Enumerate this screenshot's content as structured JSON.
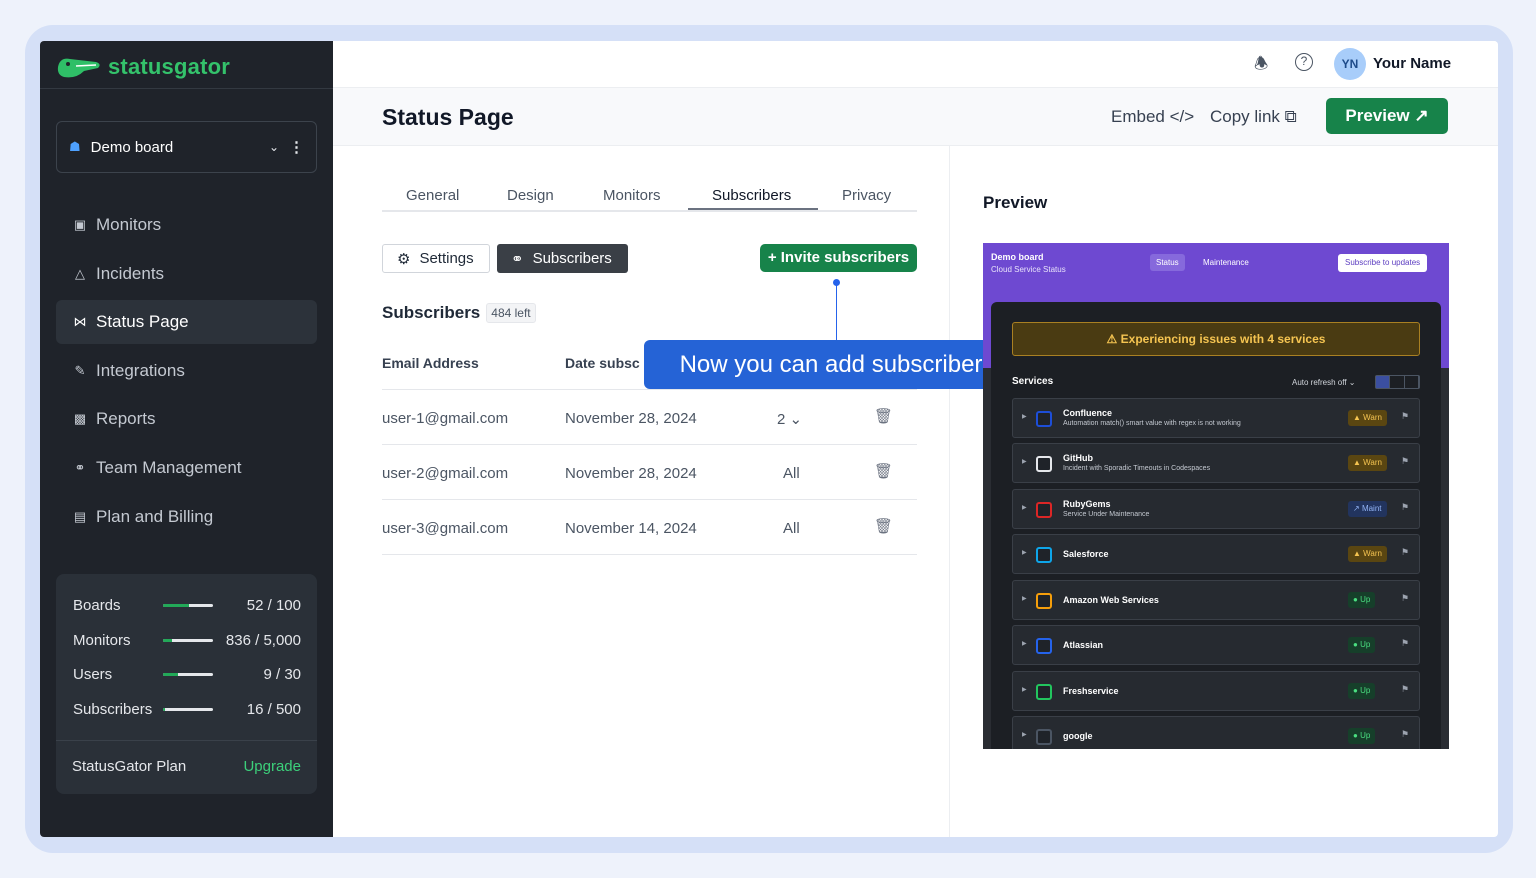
{
  "app": {
    "brand": "statusgator"
  },
  "sidebar": {
    "board_name": "Demo board",
    "items": [
      {
        "label": "Monitors",
        "icon": "monitor-icon"
      },
      {
        "label": "Incidents",
        "icon": "warning-icon"
      },
      {
        "label": "Status Page",
        "icon": "broadcast-icon"
      },
      {
        "label": "Integrations",
        "icon": "puzzle-icon"
      },
      {
        "label": "Reports",
        "icon": "bar-chart-icon"
      },
      {
        "label": "Team Management",
        "icon": "user-icon"
      },
      {
        "label": "Plan and Billing",
        "icon": "credit-card-icon"
      }
    ],
    "usage": [
      {
        "label": "Boards",
        "value": "52 / 100",
        "fraction": 0.52
      },
      {
        "label": "Monitors",
        "value": "836 / 5,000",
        "fraction": 0.17
      },
      {
        "label": "Users",
        "value": "9 / 30",
        "fraction": 0.3
      },
      {
        "label": "Subscribers",
        "value": "16 / 500",
        "fraction": 0.03
      }
    ],
    "plan_label": "StatusGator Plan",
    "upgrade_label": "Upgrade"
  },
  "topbar": {
    "avatar_initials": "YN",
    "user_name": "Your Name"
  },
  "header": {
    "title": "Status Page",
    "embed_label": "Embed",
    "copy_label": "Copy link",
    "preview_label": "Preview"
  },
  "tabs": [
    "General",
    "Design",
    "Monitors",
    "Subscribers",
    "Privacy"
  ],
  "subs": {
    "settings_label": "Settings",
    "subscribers_label": "Subscribers",
    "invite_label": "Invite subscribers",
    "title": "Subscribers",
    "left_badge": "484 left",
    "col_email": "Email Address",
    "col_date": "Date subsc",
    "rows": [
      {
        "email": "user-1@gmail.com",
        "date": "November 28, 2024",
        "scope": "2"
      },
      {
        "email": "user-2@gmail.com",
        "date": "November 28, 2024",
        "scope": "All"
      },
      {
        "email": "user-3@gmail.com",
        "date": "November 14, 2024",
        "scope": "All"
      }
    ]
  },
  "callout": "Now you can add subscribers",
  "preview": {
    "title": "Preview",
    "board": "Demo board",
    "subtitle": "Cloud Service Status",
    "tab_status": "Status",
    "tab_maintenance": "Maintenance",
    "subscribe_label": "Subscribe to updates",
    "alert": "Experiencing issues with 4 services",
    "services_label": "Services",
    "auto_refresh": "Auto refresh off",
    "services": [
      {
        "name": "Confluence",
        "desc": "Automation match() smart value with regex is not working",
        "status": "Warn",
        "kind": "warn",
        "color": "#1d4ed8"
      },
      {
        "name": "GitHub",
        "desc": "Incident with Sporadic Timeouts in Codespaces",
        "status": "Warn",
        "kind": "warn",
        "color": "#e5e7eb"
      },
      {
        "name": "RubyGems",
        "desc": "Service Under Maintenance",
        "status": "Maint",
        "kind": "maint",
        "color": "#dc2626"
      },
      {
        "name": "Salesforce",
        "desc": "",
        "status": "Warn",
        "kind": "warn",
        "color": "#0ea5e9"
      },
      {
        "name": "Amazon Web Services",
        "desc": "",
        "status": "Up",
        "kind": "up",
        "color": "#f59e0b"
      },
      {
        "name": "Atlassian",
        "desc": "",
        "status": "Up",
        "kind": "up",
        "color": "#2563eb"
      },
      {
        "name": "Freshservice",
        "desc": "",
        "status": "Up",
        "kind": "up",
        "color": "#22c55e"
      },
      {
        "name": "google",
        "desc": "",
        "status": "Up",
        "kind": "up",
        "color": "#4b5563"
      }
    ]
  }
}
